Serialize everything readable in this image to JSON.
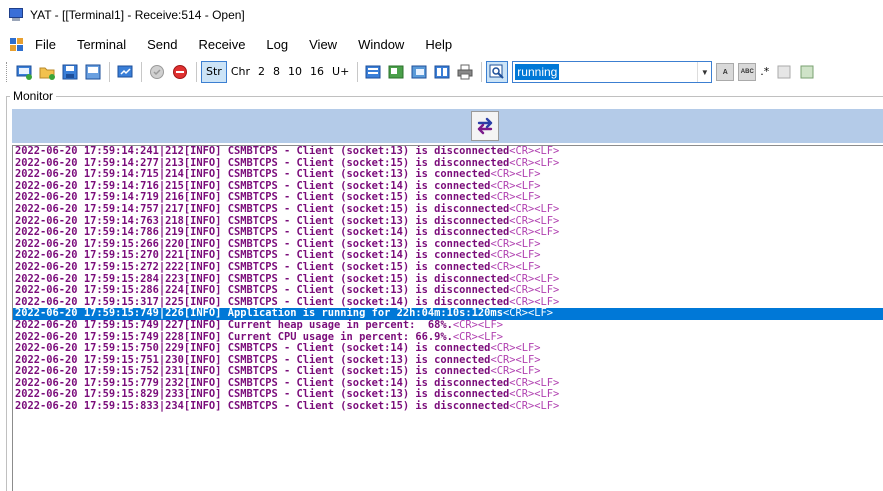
{
  "window": {
    "title": "YAT - [[Terminal1] - Receive:514 - Open]"
  },
  "menu": [
    "File",
    "Terminal",
    "Send",
    "Receive",
    "Log",
    "View",
    "Window",
    "Help"
  ],
  "toolbar": {
    "radix_buttons": [
      {
        "label": "Str",
        "checked": true
      },
      {
        "label": "Chr",
        "checked": false
      },
      {
        "label": "2",
        "checked": false
      },
      {
        "label": "8",
        "checked": false
      },
      {
        "label": "10",
        "checked": false
      },
      {
        "label": "16",
        "checked": false
      },
      {
        "label": "U+",
        "checked": false
      }
    ],
    "find_value": "running",
    "case_label": "A",
    "whole_word_label": "ABC",
    "regex_label": ".*"
  },
  "monitor": {
    "label": "Monitor",
    "eol": "<CR><LF>",
    "selected_index": 14,
    "lines": [
      "2022-06-20 17:59:14:241|212[INFO] CSMBTCPS - Client (socket:13) is disconnected",
      "2022-06-20 17:59:14:277|213[INFO] CSMBTCPS - Client (socket:15) is disconnected",
      "2022-06-20 17:59:14:715|214[INFO] CSMBTCPS - Client (socket:13) is connected",
      "2022-06-20 17:59:14:716|215[INFO] CSMBTCPS - Client (socket:14) is connected",
      "2022-06-20 17:59:14:719|216[INFO] CSMBTCPS - Client (socket:15) is connected",
      "2022-06-20 17:59:14:757|217[INFO] CSMBTCPS - Client (socket:15) is disconnected",
      "2022-06-20 17:59:14:763|218[INFO] CSMBTCPS - Client (socket:13) is disconnected",
      "2022-06-20 17:59:14:786|219[INFO] CSMBTCPS - Client (socket:14) is disconnected",
      "2022-06-20 17:59:15:266|220[INFO] CSMBTCPS - Client (socket:13) is connected",
      "2022-06-20 17:59:15:270|221[INFO] CSMBTCPS - Client (socket:14) is connected",
      "2022-06-20 17:59:15:272|222[INFO] CSMBTCPS - Client (socket:15) is connected",
      "2022-06-20 17:59:15:284|223[INFO] CSMBTCPS - Client (socket:15) is disconnected",
      "2022-06-20 17:59:15:286|224[INFO] CSMBTCPS - Client (socket:13) is disconnected",
      "2022-06-20 17:59:15:317|225[INFO] CSMBTCPS - Client (socket:14) is disconnected",
      "2022-06-20 17:59:15:749|226[INFO] Application is running for 22h:04m:10s:120ms",
      "2022-06-20 17:59:15:749|227[INFO] Current heap usage in percent:  68%.",
      "2022-06-20 17:59:15:749|228[INFO] Current CPU usage in percent: 66.9%.",
      "2022-06-20 17:59:15:750|229[INFO] CSMBTCPS - Client (socket:14) is connected",
      "2022-06-20 17:59:15:751|230[INFO] CSMBTCPS - Client (socket:13) is connected",
      "2022-06-20 17:59:15:752|231[INFO] CSMBTCPS - Client (socket:15) is connected",
      "2022-06-20 17:59:15:779|232[INFO] CSMBTCPS - Client (socket:14) is disconnected",
      "2022-06-20 17:59:15:829|233[INFO] CSMBTCPS - Client (socket:13) is disconnected",
      "2022-06-20 17:59:15:833|234[INFO] CSMBTCPS - Client (socket:15) is disconnected"
    ]
  },
  "colors": {
    "log_text": "#7a0c7a",
    "selection": "#0078d7",
    "direction_bar": "#b4cbe8"
  }
}
